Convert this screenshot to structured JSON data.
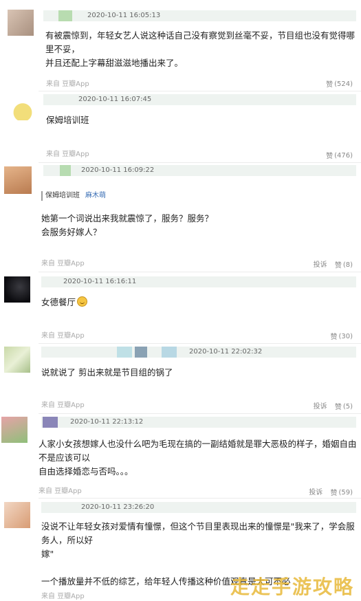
{
  "comments": [
    {
      "timestamp": "2020-10-11 16:05:13",
      "text": "有被震惊到，年轻女艺人说这种话自己没有察觉到丝毫不妥，节目组也没有觉得哪里不妥，\n并且还配上字幕甜滋滋地播出来了。",
      "source": "来自 豆瓣App",
      "like_label": "赞",
      "like_count": "(524)"
    },
    {
      "timestamp": "2020-10-11 16:07:45",
      "text": "保姆培训班",
      "source": "来自 豆瓣App",
      "like_label": "赞",
      "like_count": "(476)"
    },
    {
      "timestamp": "2020-10-11 16:09:22",
      "quote_text": "保姆培训班",
      "quote_author": "麻木萌",
      "text": "她第一个词说出来我就震惊了，服务？服务？\n会服务好嫁人？",
      "source": "来自 豆瓣App",
      "report_label": "投诉",
      "like_label": "赞",
      "like_count": "(8)"
    },
    {
      "timestamp": "2020-10-11 16:16:11",
      "text": "女德餐厅",
      "source": "来自 豆瓣App",
      "like_label": "赞",
      "like_count": "(30)"
    },
    {
      "timestamp": "2020-10-11 22:02:32",
      "text": "说就说了 剪出来就是节目组的锅了",
      "source": "来自 豆瓣App",
      "report_label": "投诉",
      "like_label": "赞",
      "like_count": "(5)"
    },
    {
      "timestamp": "2020-10-11 22:13:12",
      "text": "人家小女孩想嫁人也没什么吧为毛现在搞的一副结婚就是罪大恶极的样子，婚姻自由不是应该可以\n自由选择婚恋与否吗。。。",
      "source": "来自 豆瓣App",
      "report_label": "投诉",
      "like_label": "赞",
      "like_count": "(59)"
    },
    {
      "timestamp": "2020-10-11 23:26:20",
      "text": "没说不让年轻女孩对爱情有憧憬，但这个节目里表现出来的憧憬是\"我来了，学会服务人，所以好\n嫁\"\n\n一个播放量并不低的综艺，给年轻人传播这种价值观真是大可不必",
      "source": "来自 豆瓣App"
    }
  ],
  "watermark": "走走手游攻略",
  "colors": {
    "name_bar": "#eef3f0",
    "quote_author": "#3b6fb5",
    "watermark": "#e8b93a"
  }
}
